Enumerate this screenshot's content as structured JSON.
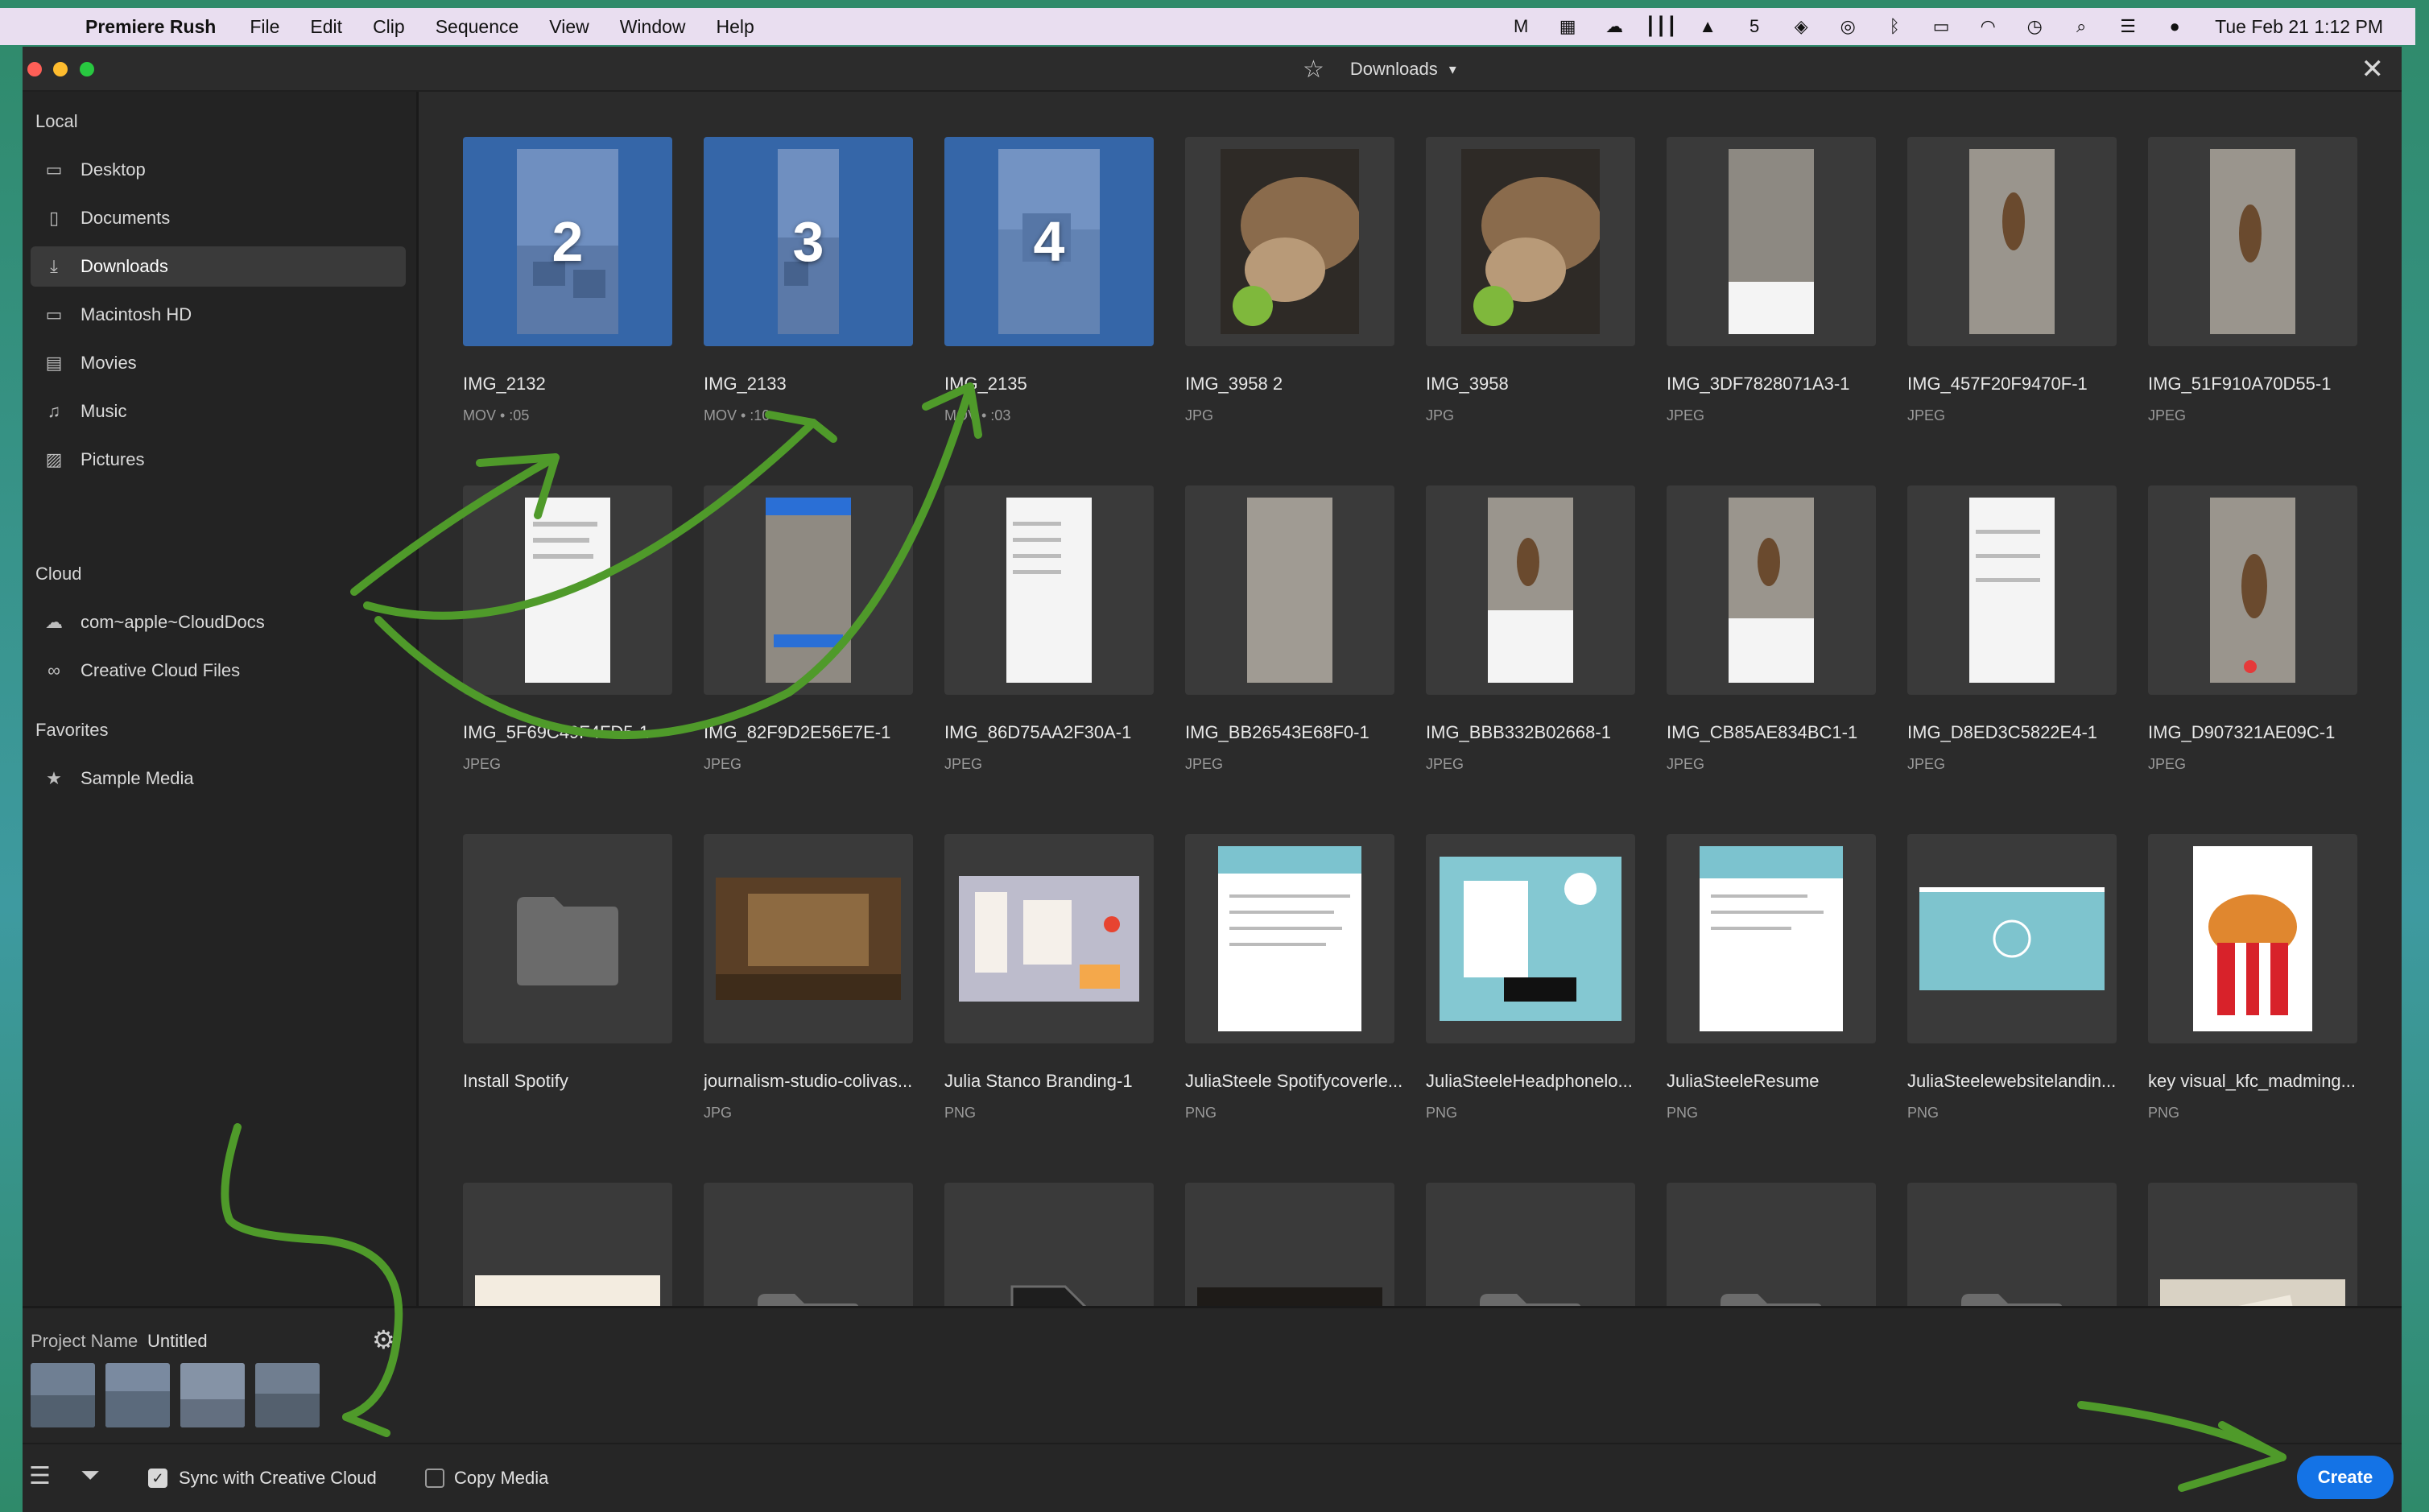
{
  "menubar": {
    "apple_icon": "apple-icon",
    "app_name": "Premiere Rush",
    "menus": [
      "File",
      "Edit",
      "Clip",
      "Sequence",
      "View",
      "Window",
      "Help"
    ],
    "status_icons": [
      "malwarebytes-icon",
      "box-icon",
      "creative-cloud-icon",
      "audio-icon",
      "drive-icon",
      "app5-icon",
      "dropbox-icon",
      "airdrop-icon",
      "bluetooth-icon",
      "battery-icon",
      "wifi-icon",
      "time-machine-icon",
      "spotlight-icon",
      "control-center-icon",
      "siri-icon"
    ],
    "clock": "Tue Feb 21  1:12 PM"
  },
  "window": {
    "location": "Downloads",
    "colors": {
      "selected_tile": "#3566a8",
      "create_button": "#1473e6",
      "annotation": "#4f9a2a"
    }
  },
  "sidebar": {
    "sections": [
      {
        "title": "Local",
        "items": [
          {
            "label": "Desktop",
            "icon": "desktop-icon"
          },
          {
            "label": "Documents",
            "icon": "document-icon"
          },
          {
            "label": "Downloads",
            "icon": "download-icon",
            "active": true
          },
          {
            "label": "Macintosh HD",
            "icon": "monitor-icon"
          },
          {
            "label": "Movies",
            "icon": "film-icon"
          },
          {
            "label": "Music",
            "icon": "music-icon"
          },
          {
            "label": "Pictures",
            "icon": "picture-icon"
          }
        ]
      },
      {
        "title": "Cloud",
        "items": [
          {
            "label": "com~apple~CloudDocs",
            "icon": "cloud-icon"
          },
          {
            "label": "Creative Cloud Files",
            "icon": "creative-cloud-icon"
          }
        ]
      },
      {
        "title": "Favorites",
        "items": [
          {
            "label": "Sample Media",
            "icon": "star-icon"
          }
        ]
      }
    ]
  },
  "grid": {
    "files": [
      {
        "name": "IMG_2132",
        "meta": "MOV • :05",
        "selected": true,
        "badge": "2"
      },
      {
        "name": "IMG_2133",
        "meta": "MOV • :10",
        "selected": true,
        "badge": "3"
      },
      {
        "name": "IMG_2135",
        "meta": "MOV • :03",
        "selected": true,
        "badge": "4"
      },
      {
        "name": "IMG_3958 2",
        "meta": "JPG"
      },
      {
        "name": "IMG_3958",
        "meta": "JPG"
      },
      {
        "name": "IMG_3DF7828071A3-1",
        "meta": "JPEG"
      },
      {
        "name": "IMG_457F20F9470F-1",
        "meta": "JPEG"
      },
      {
        "name": "IMG_51F910A70D55-1",
        "meta": "JPEG"
      },
      {
        "name": "IMG_5F69C49F4FD5-1",
        "meta": "JPEG"
      },
      {
        "name": "IMG_82F9D2E56E7E-1",
        "meta": "JPEG"
      },
      {
        "name": "IMG_86D75AA2F30A-1",
        "meta": "JPEG"
      },
      {
        "name": "IMG_BB26543E68F0-1",
        "meta": "JPEG"
      },
      {
        "name": "IMG_BBB332B02668-1",
        "meta": "JPEG"
      },
      {
        "name": "IMG_CB85AE834BC1-1",
        "meta": "JPEG"
      },
      {
        "name": "IMG_D8ED3C5822E4-1",
        "meta": "JPEG"
      },
      {
        "name": "IMG_D907321AE09C-1",
        "meta": "JPEG"
      },
      {
        "name": "Install Spotify",
        "meta": ""
      },
      {
        "name": "journalism-studio-colivas...",
        "meta": "JPG"
      },
      {
        "name": "Julia Stanco Branding-1",
        "meta": "PNG"
      },
      {
        "name": "JuliaSteele Spotifycoverle...",
        "meta": "PNG"
      },
      {
        "name": "JuliaSteeleHeadphonelo...",
        "meta": "PNG"
      },
      {
        "name": "JuliaSteeleResume",
        "meta": "PNG"
      },
      {
        "name": "JuliaSteelewebsitelandin...",
        "meta": "PNG"
      },
      {
        "name": "key visual_kfc_madming...",
        "meta": "PNG"
      }
    ]
  },
  "project": {
    "name_label": "Project Name",
    "name_value": "Untitled"
  },
  "bottom": {
    "sync_label": "Sync with Creative Cloud",
    "sync_checked": true,
    "copy_label": "Copy Media",
    "copy_checked": false,
    "create_label": "Create"
  }
}
